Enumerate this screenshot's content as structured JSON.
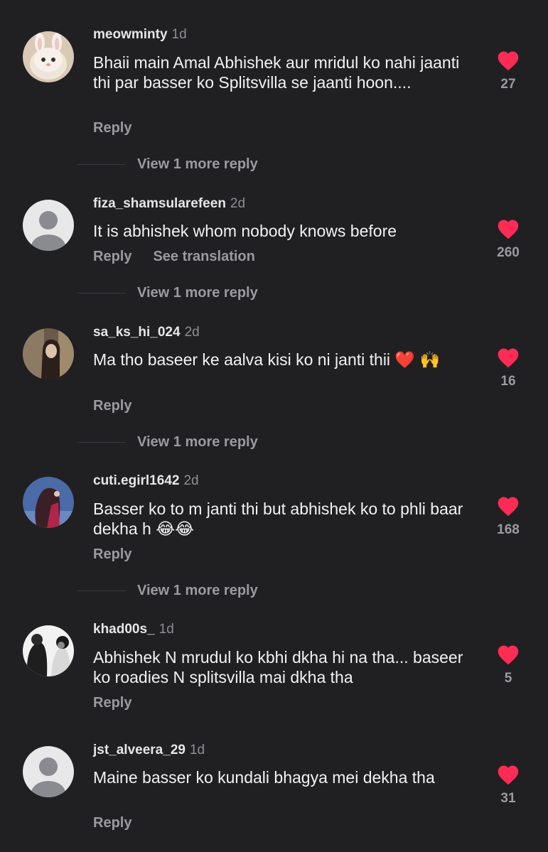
{
  "comments": [
    {
      "username": "meowminty",
      "time": "1d",
      "text": "Bhaii main Amal Abhishek aur mridul ko nahi jaanti thi par basser ko Splitsvilla se jaanti hoon....",
      "reply_label": "Reply",
      "likes": "27",
      "view_more": "View 1 more reply",
      "avatar": "cat-avatar"
    },
    {
      "username": "fiza_shamsularefeen",
      "time": "2d",
      "text": "It is abhishek whom nobody knows before",
      "reply_label": "Reply",
      "translate_label": "See translation",
      "likes": "260",
      "view_more": "View 1 more reply",
      "avatar": "default-avatar"
    },
    {
      "username": "sa_ks_hi_024",
      "time": "2d",
      "text": "Ma tho baseer ke aalva kisi ko ni janti thii ❤️ 🙌",
      "reply_label": "Reply",
      "likes": "16",
      "view_more": "View 1 more reply",
      "avatar": "photo-avatar"
    },
    {
      "username": "cuti.egirl1642",
      "time": "2d",
      "text": "Basser ko to m janti thi but abhishek ko to phli baar dekha h 😂😂",
      "reply_label": "Reply",
      "likes": "168",
      "view_more": "View 1 more reply",
      "avatar": "photo-avatar"
    },
    {
      "username": "khad00s_",
      "time": "1d",
      "text": "Abhishek N mrudul ko kbhi dkha hi na tha... baseer ko roadies N splitsvilla mai dkha tha",
      "reply_label": "Reply",
      "likes": "5",
      "avatar": "photo-avatar"
    },
    {
      "username": "jst_alveera_29",
      "time": "1d",
      "text": "Maine basser ko kundali bhagya mei dekha tha",
      "reply_label": "Reply",
      "likes": "31",
      "avatar": "default-avatar"
    }
  ],
  "colors": {
    "background": "#202023",
    "heart": "#fe2c55",
    "secondary_text": "#9a9aa0"
  }
}
